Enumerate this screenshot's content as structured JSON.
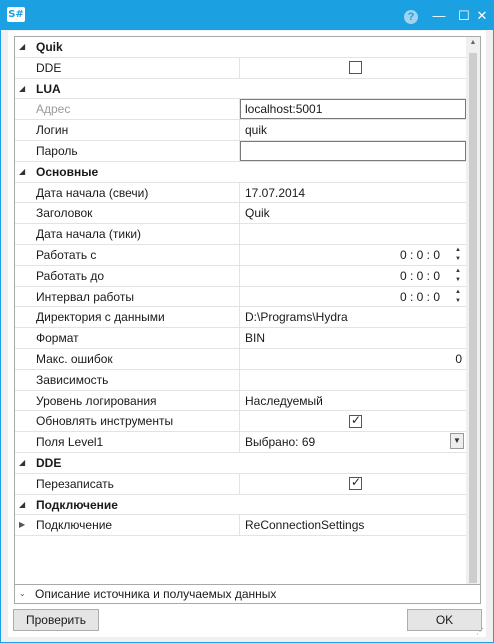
{
  "window": {
    "title": "",
    "app_icon": "S#",
    "help_label": "?",
    "minimize_label": "—",
    "maximize_label": "☐",
    "close_label": "✕"
  },
  "grid": {
    "categories": {
      "quik": "Quik",
      "lua": "LUA",
      "main": "Основные",
      "dde": "DDE",
      "connection": "Подключение"
    },
    "rows": {
      "dde": {
        "label": "DDE",
        "checked": false
      },
      "address": {
        "label": "Адрес",
        "value": "localhost:5001"
      },
      "login": {
        "label": "Логин",
        "value": "quik"
      },
      "password": {
        "label": "Пароль",
        "value": ""
      },
      "start_date_candles": {
        "label": "Дата начала (свечи)",
        "value": "17.07.2014"
      },
      "header": {
        "label": "Заголовок",
        "value": "Quik"
      },
      "start_date_ticks": {
        "label": "Дата начала (тики)",
        "value": ""
      },
      "work_from": {
        "label": "Работать с",
        "value": "0 : 0 : 0"
      },
      "work_to": {
        "label": "Работать до",
        "value": "0 : 0 : 0"
      },
      "work_interval": {
        "label": "Интервал работы",
        "value": "0 : 0 : 0"
      },
      "data_dir": {
        "label": "Директория с данными",
        "value": "D:\\Programs\\Hydra"
      },
      "format": {
        "label": "Формат",
        "value": "BIN"
      },
      "max_errors": {
        "label": "Макс. ошибок",
        "value": "0"
      },
      "dependency": {
        "label": "Зависимость",
        "value": ""
      },
      "log_level": {
        "label": "Уровень логирования",
        "value": "Наследуемый"
      },
      "update_instruments": {
        "label": "Обновлять инструменты",
        "checked": true
      },
      "level1_fields": {
        "label": "Поля Level1",
        "value": "Выбрано: 69"
      },
      "overwrite": {
        "label": "Перезаписать",
        "checked": true
      },
      "connection": {
        "label": "Подключение",
        "value": "ReConnectionSettings"
      }
    }
  },
  "description": {
    "label": "Описание источника и получаемых данных"
  },
  "buttons": {
    "check": "Проверить",
    "ok": "OK"
  },
  "colors": {
    "titlebar": "#1ba1e2",
    "window_border": "#1aa1e6"
  }
}
